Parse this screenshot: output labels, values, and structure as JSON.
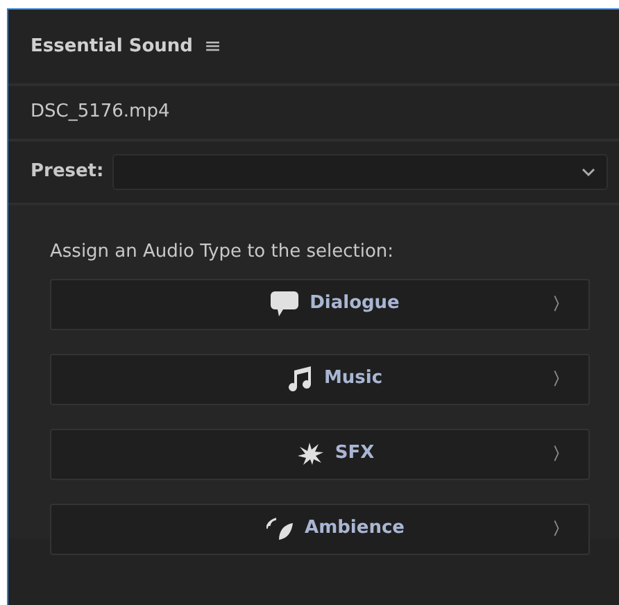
{
  "panel": {
    "title": "Essential Sound",
    "menu_icon": "≡"
  },
  "clip": {
    "name": "DSC_5176.mp4"
  },
  "preset": {
    "label": "Preset:"
  },
  "assign": {
    "prompt": "Assign an Audio Type to the selection:",
    "types": [
      {
        "kind": "dialogue",
        "label": "Dialogue",
        "chevron": "〉"
      },
      {
        "kind": "music",
        "label": "Music",
        "chevron": "〉"
      },
      {
        "kind": "sfx",
        "label": "SFX",
        "chevron": "〉"
      },
      {
        "kind": "ambience",
        "label": "Ambience",
        "chevron": "〉"
      }
    ]
  }
}
